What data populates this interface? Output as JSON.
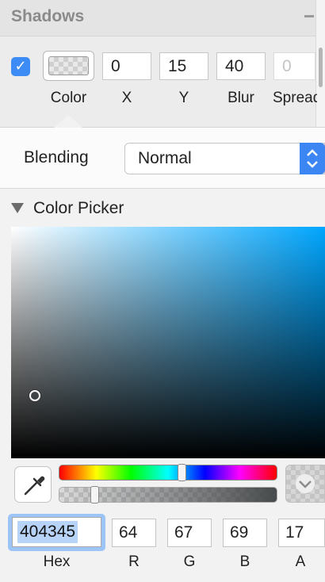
{
  "shadows": {
    "title": "Shadows",
    "enabled": true,
    "color_label": "Color",
    "fields": [
      {
        "label": "X",
        "value": "0"
      },
      {
        "label": "Y",
        "value": "15"
      },
      {
        "label": "Blur",
        "value": "40"
      },
      {
        "label": "Spread",
        "value": "0",
        "disabled": true
      }
    ]
  },
  "popover": {
    "blending": {
      "label": "Blending",
      "value": "Normal"
    },
    "color_picker": {
      "title": "Color Picker",
      "hue_color": "#00a6ff",
      "hue_fraction": 0.56,
      "alpha_fraction": 0.17,
      "hex": {
        "label": "Hex",
        "value": "404345"
      },
      "components": [
        {
          "label": "R",
          "value": "64"
        },
        {
          "label": "G",
          "value": "67"
        },
        {
          "label": "B",
          "value": "69"
        },
        {
          "label": "A",
          "value": "17"
        }
      ]
    }
  },
  "icons": {
    "checkbox": "checkmark-icon",
    "eyedropper": "eyedropper-icon",
    "select_stepper": "up-down-chevron-icon",
    "swatch_toggle": "chevron-down-icon",
    "disclosure": "disclosure-triangle-icon",
    "collapse": "minus-icon"
  },
  "colors": {
    "accent": "#3b86f2",
    "current_color": "#404345"
  }
}
